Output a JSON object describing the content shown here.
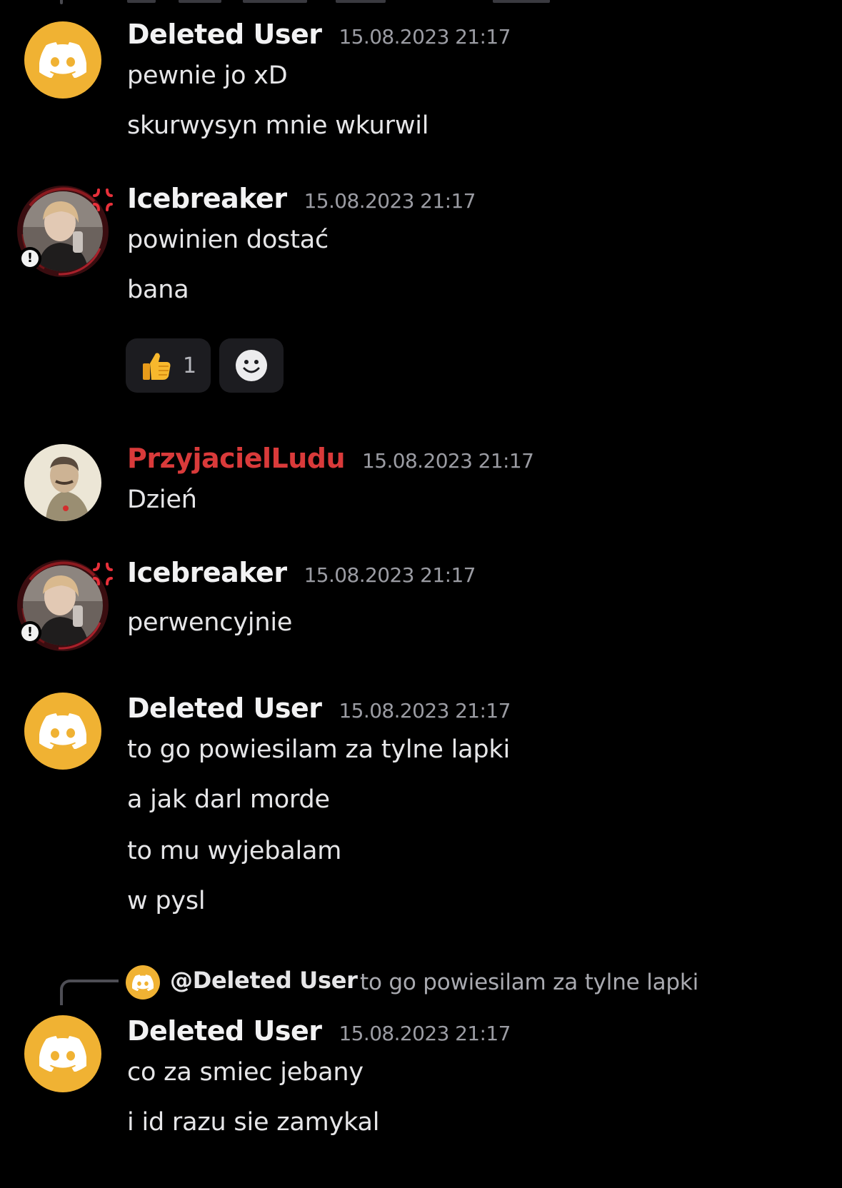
{
  "messages": [
    {
      "author": "Deleted User",
      "timestamp": "15.08.2023 21:17",
      "lines": [
        "pewnie jo xD",
        "skurwysyn mnie wkurwil"
      ]
    },
    {
      "author": "Icebreaker",
      "timestamp": "15.08.2023 21:17",
      "lines": [
        "powinien dostać",
        "bana"
      ],
      "reactions": [
        {
          "emoji": "thumbs-up-icon",
          "count": "1"
        }
      ]
    },
    {
      "author": "PrzyjacielLudu",
      "timestamp": "15.08.2023 21:17",
      "lines": [
        "Dzień"
      ]
    },
    {
      "author": "Icebreaker",
      "timestamp": "15.08.2023 21:17",
      "lines": [
        "perwencyjnie"
      ]
    },
    {
      "author": "Deleted User",
      "timestamp": "15.08.2023 21:17",
      "lines": [
        "to go powiesilam za tylne lapki",
        "a jak darl morde",
        "to mu wyjebalam",
        "w pysl"
      ]
    },
    {
      "reply": {
        "user": "@Deleted User",
        "text": "to go powiesilam za tylne lapki"
      },
      "author": "Deleted User",
      "timestamp": "15.08.2023 21:17",
      "lines": [
        "co za smiec jebany",
        "i id razu sie zamykal"
      ]
    }
  ],
  "colors": {
    "background": "#000000",
    "discord_avatar": "#f0b233",
    "username_red": "#d93a3a",
    "timestamp": "#9b9ca3"
  }
}
